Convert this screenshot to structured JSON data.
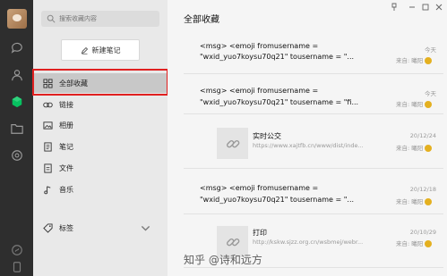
{
  "sidebar": {
    "search_placeholder": "搜索收藏内容",
    "new_note_label": "新建笔记",
    "categories": [
      {
        "label": "全部收藏",
        "icon": "grid-icon"
      },
      {
        "label": "链接",
        "icon": "link-icon"
      },
      {
        "label": "相册",
        "icon": "image-icon"
      },
      {
        "label": "笔记",
        "icon": "note-icon"
      },
      {
        "label": "文件",
        "icon": "file-icon"
      },
      {
        "label": "音乐",
        "icon": "music-icon"
      },
      {
        "label": "标签",
        "icon": "tag-icon"
      }
    ]
  },
  "main": {
    "title": "全部收藏",
    "items": [
      {
        "line1": "<msg> <emoji fromusername =",
        "line2": "\"wxid_yuo7koysu70q21\" tousername = \"...",
        "date": "今天",
        "source": "来自: 曦阳"
      },
      {
        "line1": "<msg> <emoji fromusername =",
        "line2": "\"wxid_yuo7koysu70q21\" tousername = \"fi...",
        "date": "今天",
        "source": "来自: 曦阳"
      },
      {
        "title": "实时公交",
        "url": "https://www.xajtfb.cn/www/dist/inde...",
        "date": "20/12/24",
        "source": "来自: 曦阳"
      },
      {
        "line1": "<msg> <emoji fromusername =",
        "line2": "\"wxid_yuo7koysu70q21\" tousername = \"...",
        "date": "20/12/18",
        "source": "来自: 曦阳"
      },
      {
        "title": "打印",
        "url": "http://kskw.sjzz.org.cn/wsbmej/webr...",
        "date": "20/10/29",
        "source": "来自: 曦阳"
      }
    ]
  },
  "watermark": "知乎 @诗和远方",
  "colors": {
    "rail": "#2e2e2e",
    "sidebar": "#e9e9e9",
    "active": "#c8c8c8",
    "annotation": "#e02020",
    "accent": "#07c160"
  }
}
